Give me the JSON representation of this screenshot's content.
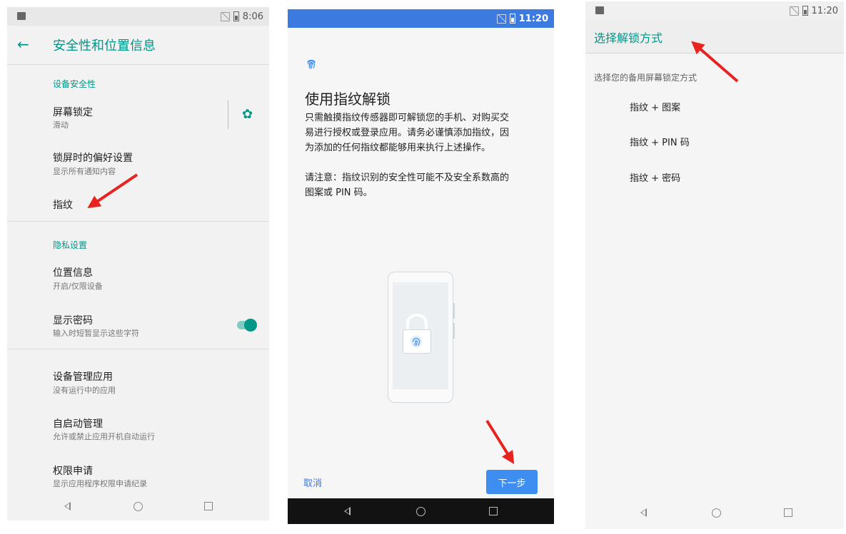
{
  "screen1": {
    "status_time": "8:06",
    "title": "安全性和位置信息",
    "section_device_security": "设备安全性",
    "screen_lock_title": "屏幕锁定",
    "screen_lock_sub": "滑动",
    "lockscreen_pref_title": "锁屏时的偏好设置",
    "lockscreen_pref_sub": "显示所有通知内容",
    "fingerprint_title": "指纹",
    "section_privacy": "隐私设置",
    "location_title": "位置信息",
    "location_sub": "开启/仅限设备",
    "show_password_title": "显示密码",
    "show_password_sub": "输入时短暂显示这些字符",
    "show_password_on": true,
    "device_admin_title": "设备管理应用",
    "device_admin_sub": "没有运行中的应用",
    "autostart_title": "自启动管理",
    "autostart_sub": "允许或禁止应用开机自动运行",
    "permission_title": "权限申请",
    "permission_sub": "显示应用程序权限申请纪录"
  },
  "screen2": {
    "status_time": "11:20",
    "title": "使用指纹解锁",
    "desc1_line1": "只需触摸指纹传感器即可解锁您的手机、对购买交",
    "desc1_line2": "易进行授权或登录应用。请务必谨慎添加指纹，因",
    "desc1_line3": "为添加的任何指纹都能够用来执行上述操作。",
    "desc2_line1": "请注意：指纹识别的安全性可能不及安全系数高的",
    "desc2_line2": "图案或 PIN 码。",
    "cancel_label": "取消",
    "next_label": "下一步",
    "accent_color": "#3d8ef0"
  },
  "screen3": {
    "status_time": "11:20",
    "title": "选择解锁方式",
    "subtitle": "选择您的备用屏幕锁定方式",
    "options": [
      "指纹 + 图案",
      "指纹 + PIN 码",
      "指纹 + 密码"
    ]
  },
  "colors": {
    "teal_accent": "#009688",
    "annotation_arrow": "#e8231f"
  }
}
